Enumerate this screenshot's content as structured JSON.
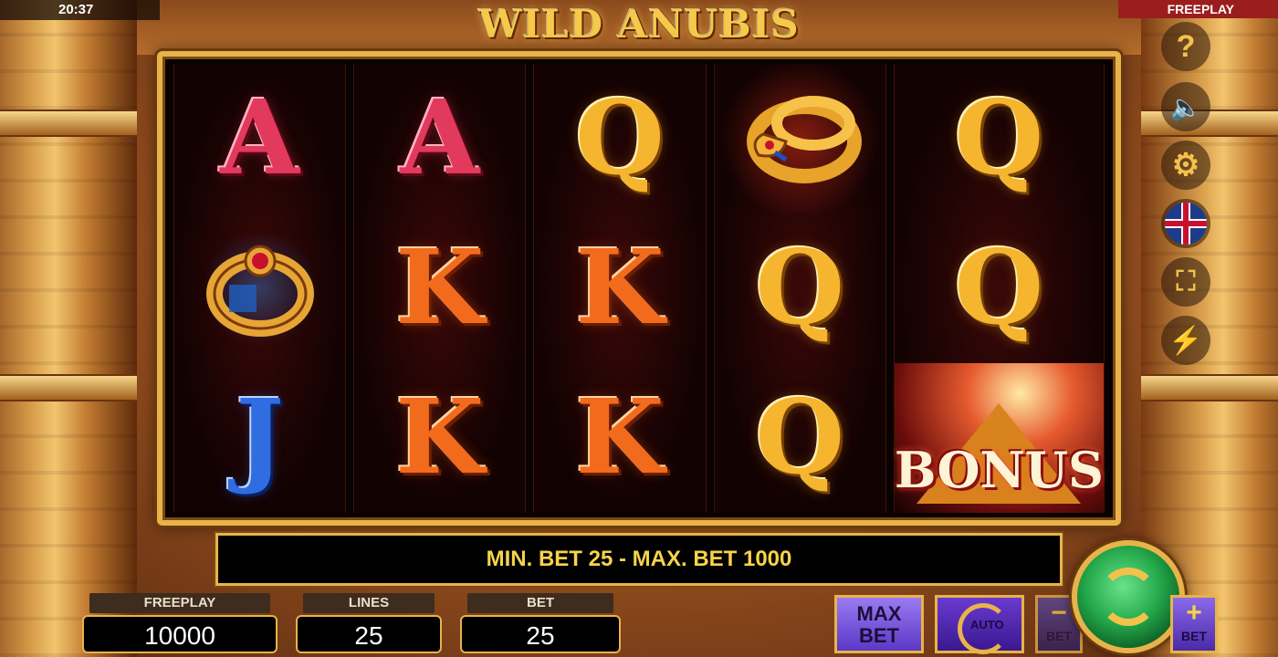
{
  "status": {
    "time": "20:37",
    "mode": "FREEPLAY"
  },
  "game": {
    "title": "WILD ANUBIS"
  },
  "reels": [
    [
      {
        "symbol": "A",
        "type": "letter"
      },
      {
        "symbol": "ring",
        "type": "icon"
      },
      {
        "symbol": "J",
        "type": "letter"
      }
    ],
    [
      {
        "symbol": "A",
        "type": "letter"
      },
      {
        "symbol": "K",
        "type": "letter"
      },
      {
        "symbol": "K",
        "type": "letter"
      }
    ],
    [
      {
        "symbol": "Q",
        "type": "letter"
      },
      {
        "symbol": "K",
        "type": "letter"
      },
      {
        "symbol": "K",
        "type": "letter"
      }
    ],
    [
      {
        "symbol": "snake",
        "type": "icon"
      },
      {
        "symbol": "Q",
        "type": "letter"
      },
      {
        "symbol": "Q",
        "type": "letter"
      }
    ],
    [
      {
        "symbol": "Q",
        "type": "letter"
      },
      {
        "symbol": "Q",
        "type": "letter"
      },
      {
        "symbol": "BONUS",
        "type": "bonus"
      }
    ]
  ],
  "info": {
    "message": "MIN. BET 25 - MAX. BET 1000"
  },
  "stats": {
    "freeplay": {
      "label": "FREEPLAY",
      "value": "10000"
    },
    "lines": {
      "label": "LINES",
      "value": "25"
    },
    "bet": {
      "label": "BET",
      "value": "25"
    }
  },
  "buttons": {
    "max_bet_line1": "MAX",
    "max_bet_line2": "BET",
    "auto": "AUTO",
    "bet_minus_sign": "−",
    "bet_minus_label": "BET",
    "bet_plus_sign": "+",
    "bet_plus_label": "BET"
  },
  "side_icons": [
    "help-icon",
    "sound-muted-icon",
    "settings-gear-icon",
    "language-uk-flag-icon",
    "fullscreen-icon",
    "turbo-lightning-icon"
  ],
  "side_glyphs": {
    "help": "?",
    "sound": "🔈",
    "settings": "⚙",
    "fullscreen": "⛶",
    "turbo": "⚡"
  },
  "colors": {
    "accent_gold": "#e8b34a",
    "spin_green": "#23a84a",
    "button_purple": "#5a38c6",
    "info_text": "#f7d34a"
  }
}
